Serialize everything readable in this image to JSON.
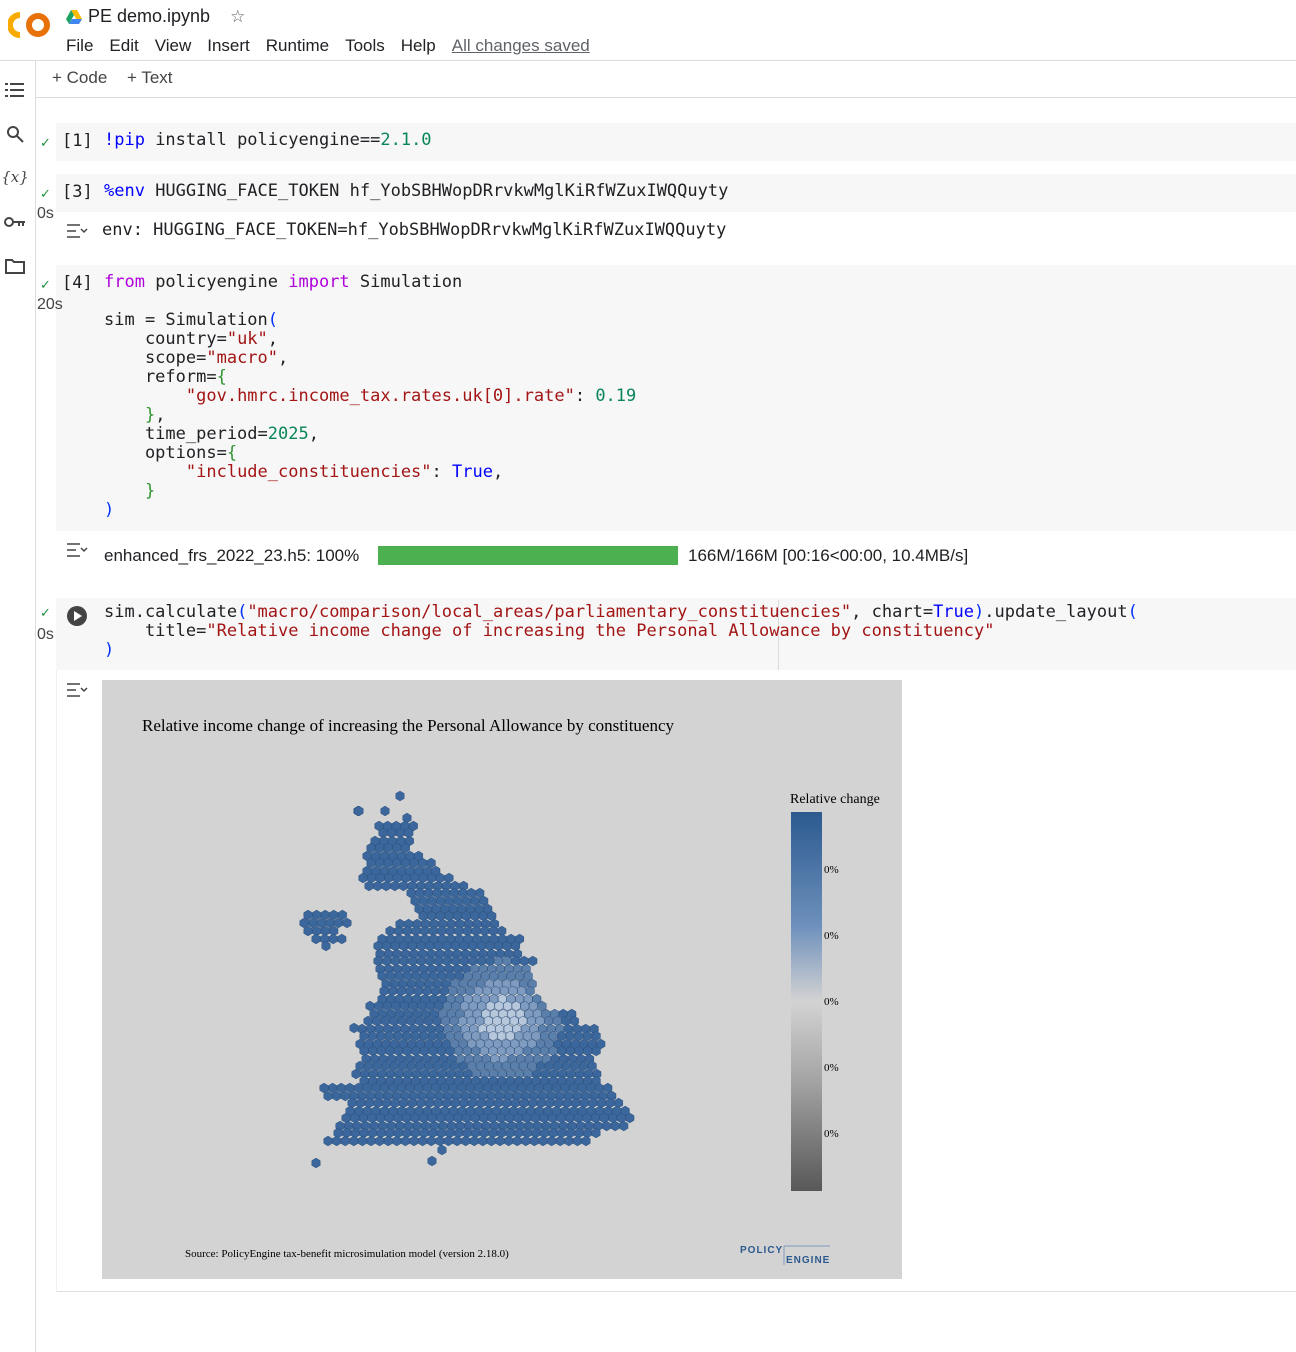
{
  "app": {
    "notebook_title": "PE demo.ipynb",
    "menu": [
      "File",
      "Edit",
      "View",
      "Insert",
      "Runtime",
      "Tools",
      "Help"
    ],
    "save_status": "All changes saved"
  },
  "toolbar": {
    "add_code_label": "+ Code",
    "add_text_label": "+ Text"
  },
  "cells": [
    {
      "prompt": "[1]",
      "exec_time": ""
    },
    {
      "prompt": "[3]",
      "exec_time": "0s",
      "output": "env: HUGGING_FACE_TOKEN=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"
    },
    {
      "prompt": "[4]",
      "exec_time": "20s"
    },
    {
      "prompt": "",
      "exec_time": "0s"
    }
  ],
  "progress": {
    "file_label": "enhanced_frs_2022_23.h5: 100%",
    "fraction": 1.0,
    "stats": "166M/166M [00:16<00:00, 10.4MB/s]"
  },
  "figure": {
    "title": "Relative income change of increasing the Personal Allowance by constituency",
    "colorbar_title": "Relative change",
    "tick_labels": [
      "0%",
      "0%",
      "0%",
      "0%",
      "0%"
    ],
    "source": "Source: PolicyEngine tax-benefit microsimulation model (version 2.18.0)",
    "logo_top": "POLICY",
    "logo_bottom": "ENGINE"
  },
  "colors": {
    "hex_fill": "#3b679c",
    "hex_stroke": "#2a4f7c",
    "progress_fill": "#4caf50",
    "check": "#1e8e3e"
  }
}
